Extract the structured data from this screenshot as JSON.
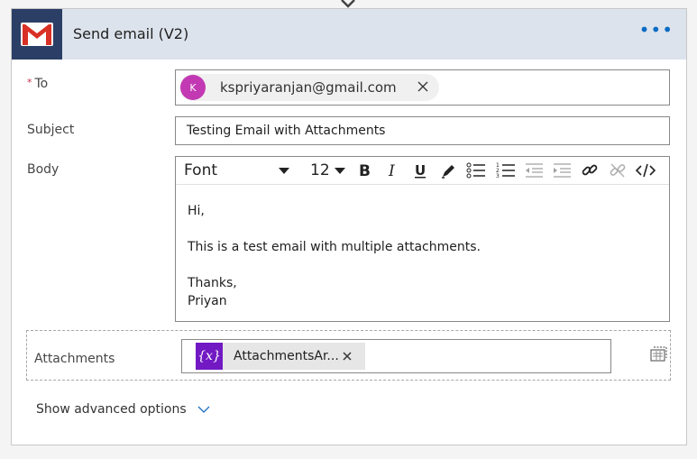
{
  "action": {
    "title": "Send email (V2)",
    "more_label": "•••",
    "brand_color": "#2b3e66",
    "icon": "gmail-icon"
  },
  "fields": {
    "to": {
      "label": "To",
      "required_mark": "*",
      "recipient": {
        "avatar_initial": "K",
        "avatar_color": "#c239b3",
        "email": "kspriyaranjan@gmail.com"
      }
    },
    "subject": {
      "label": "Subject",
      "value": "Testing Email with Attachments"
    },
    "body": {
      "label": "Body",
      "toolbar": {
        "font": "Font",
        "size": "12",
        "buttons": [
          "bold-icon",
          "italic-icon",
          "underline-icon",
          "highlight-icon",
          "bullet-list-icon",
          "numbered-list-icon",
          "decrease-indent-icon",
          "increase-indent-icon",
          "link-icon",
          "unlink-icon",
          "code-view-icon"
        ]
      },
      "lines": {
        "greeting": "Hi,",
        "message": "This is a test email with multiple attachments.",
        "closing": "Thanks,",
        "signature": "Priyan"
      }
    },
    "attachments": {
      "label": "Attachments",
      "token": {
        "icon_label": "{x}",
        "text": "AttachmentsAr...",
        "color": "#7219c4"
      }
    }
  },
  "advanced": {
    "label": "Show advanced options"
  }
}
